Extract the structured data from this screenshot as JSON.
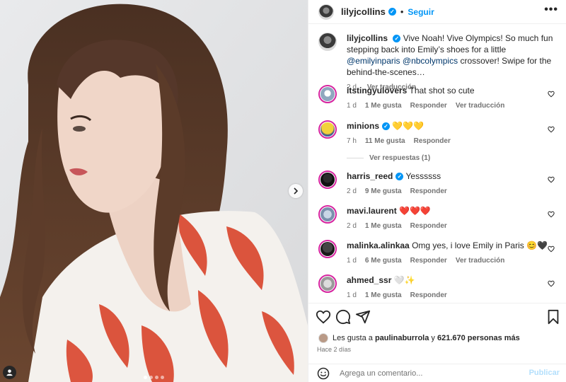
{
  "post": {
    "author": "lilyjcollins",
    "follow_label": "Seguir",
    "separator": "•",
    "more_label": "•••",
    "carousel": {
      "slides": 4,
      "active_index": 0
    }
  },
  "caption": {
    "author": "lilyjcollins",
    "text_1": "Vive Noah! Vive Olympics! So much fun stepping back into Emily’s shoes for a little ",
    "mention_1": "@emilyinparis",
    "mention_2": "@nbcolympics",
    "text_2": " crossover! Swipe for the behind-the-scenes…",
    "time": "2 d",
    "translate": "Ver traducción"
  },
  "comments": [
    {
      "user": "itstingyulovers",
      "verified": false,
      "text": "That shot so cute",
      "time": "1 d",
      "likes": "1 Me gusta",
      "reply": "Responder",
      "translate": "Ver traducción"
    },
    {
      "user": "minions",
      "verified": true,
      "text": "💛💛💛",
      "time": "7 h",
      "likes": "11 Me gusta",
      "reply": "Responder",
      "translate": ""
    },
    {
      "user": "harris_reed",
      "verified": true,
      "text": "Yessssss",
      "time": "2 d",
      "likes": "9 Me gusta",
      "reply": "Responder",
      "translate": ""
    },
    {
      "user": "mavi.laurent",
      "verified": false,
      "text": "❤️❤️❤️",
      "time": "2 d",
      "likes": "1 Me gusta",
      "reply": "Responder",
      "translate": ""
    },
    {
      "user": "malinka.alinkaa",
      "verified": false,
      "text": "Omg yes, i love Emily in Paris 😊🖤",
      "time": "1 d",
      "likes": "6 Me gusta",
      "reply": "Responder",
      "translate": "Ver traducción"
    },
    {
      "user": "ahmed_ssr",
      "verified": false,
      "text": "🤍✨",
      "time": "1 d",
      "likes": "1 Me gusta",
      "reply": "Responder",
      "translate": ""
    }
  ],
  "view_replies": "Ver respuestas (1)",
  "likes_summary": {
    "prefix": "Les gusta a ",
    "user": "paulinaburrola",
    "middle": " y ",
    "count": "621.670 personas más"
  },
  "posted_ago": "Hace 2 días",
  "comment_box": {
    "placeholder": "Agrega un comentario...",
    "publish_label": "Publicar"
  },
  "colors": {
    "accent": "#0095f6",
    "link": "#00376b",
    "muted": "#737373",
    "publish_disabled": "#b3dffc"
  }
}
